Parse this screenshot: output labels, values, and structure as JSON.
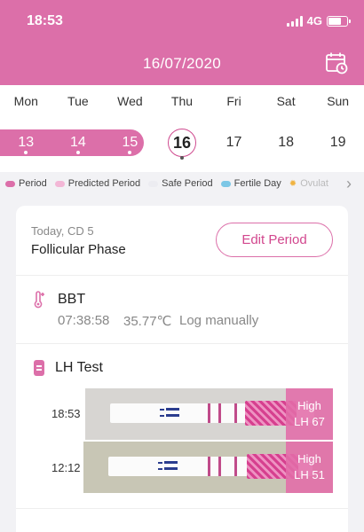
{
  "status": {
    "time": "18:53",
    "network": "4G",
    "battery_level": 0.7
  },
  "header": {
    "date": "16/07/2020",
    "calendar_icon": "calendar-clock-icon",
    "bg_color": "#dc6fa9"
  },
  "week": {
    "days": [
      "Mon",
      "Tue",
      "Wed",
      "Thu",
      "Fri",
      "Sat",
      "Sun"
    ],
    "dates": [
      "13",
      "14",
      "15",
      "16",
      "17",
      "18",
      "19"
    ],
    "today_index": 3
  },
  "legend": {
    "items": [
      {
        "label": "Period",
        "color": "#dc6fa9"
      },
      {
        "label": "Predicted Period",
        "color": "#f3b7d6"
      },
      {
        "label": "Safe Period",
        "color": "#ececf1"
      },
      {
        "label": "Fertile Day",
        "color": "#7cc7e6"
      }
    ],
    "ovulation_label": "Ovulat",
    "more_icon": "chevron-right-icon"
  },
  "summary": {
    "today_label": "Today, CD 5",
    "phase": "Follicular Phase",
    "edit_button": "Edit Period"
  },
  "bbt": {
    "title": "BBT",
    "time": "07:38:58",
    "temp": "35.77℃",
    "log": "Log manually",
    "icon": "thermometer-icon"
  },
  "lh": {
    "title": "LH Test",
    "icon": "test-strip-icon",
    "tests": [
      {
        "time": "18:53",
        "level": "High",
        "value": "LH 67"
      },
      {
        "time": "12:12",
        "level": "High",
        "value": "LH 51"
      }
    ]
  }
}
